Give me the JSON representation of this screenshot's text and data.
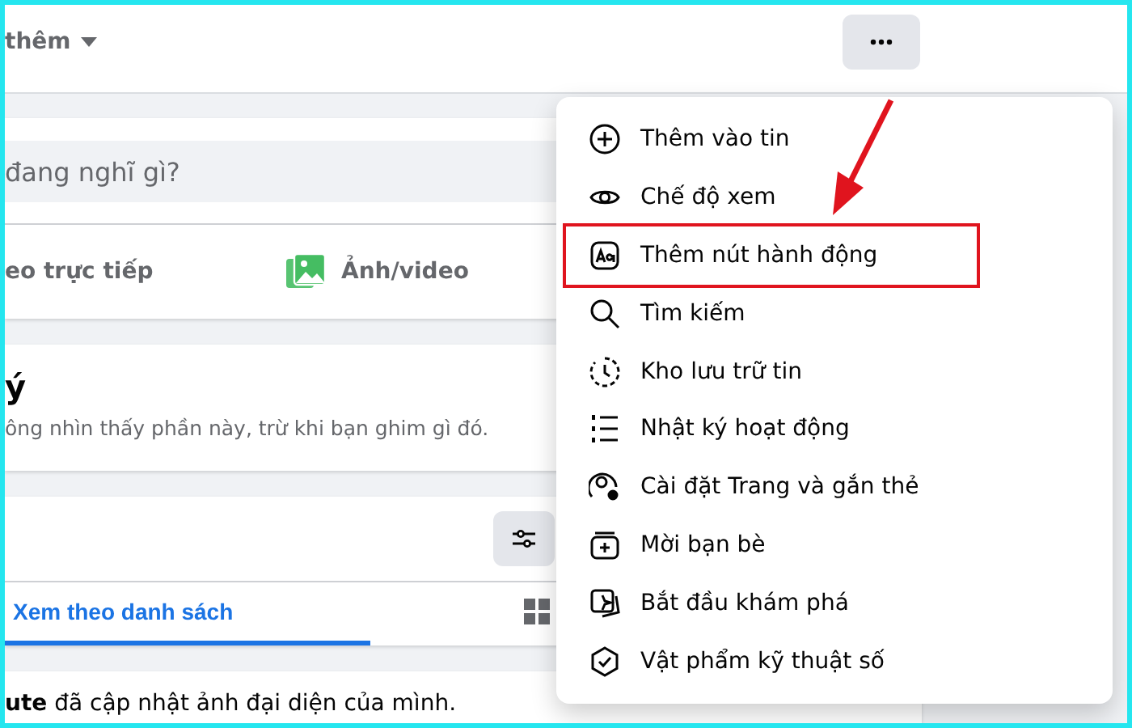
{
  "header": {
    "menu_label": "thêm"
  },
  "composer": {
    "placeholder": "đang nghĩ gì?",
    "actions": [
      {
        "kind": "live",
        "label": "eo trực tiếp"
      },
      {
        "kind": "photo",
        "label": "Ảnh/video"
      }
    ]
  },
  "pinned": {
    "title": "ý",
    "text": "ông nhìn thấy phần này, trừ khi bạn ghim gì đó."
  },
  "posts": {
    "tabs": [
      {
        "label": "Xem theo danh sách",
        "selected": true,
        "kind": "list"
      },
      {
        "kind": "grid",
        "selected": false
      }
    ]
  },
  "post": {
    "text": "**ute** đã cập nhật ảnh đại diện của mình."
  },
  "menu": {
    "items": [
      {
        "label": "Thêm vào tin",
        "highlighted": false
      },
      {
        "label": "Chế độ xem",
        "highlighted": false
      },
      {
        "label": "Thêm nút hành động",
        "highlighted": true
      },
      {
        "label": "Tìm kiếm",
        "highlighted": false
      },
      {
        "label": "Kho lưu trữ tin",
        "highlighted": false
      },
      {
        "label": "Nhật ký hoạt động",
        "highlighted": false
      },
      {
        "label": "Cài đặt Trang và gắn thẻ",
        "highlighted": false
      },
      {
        "label": "Mời bạn bè",
        "highlighted": false
      },
      {
        "label": "Bắt đầu khám phá",
        "highlighted": false
      },
      {
        "label": "Vật phẩm kỹ thuật số",
        "highlighted": false
      }
    ]
  }
}
